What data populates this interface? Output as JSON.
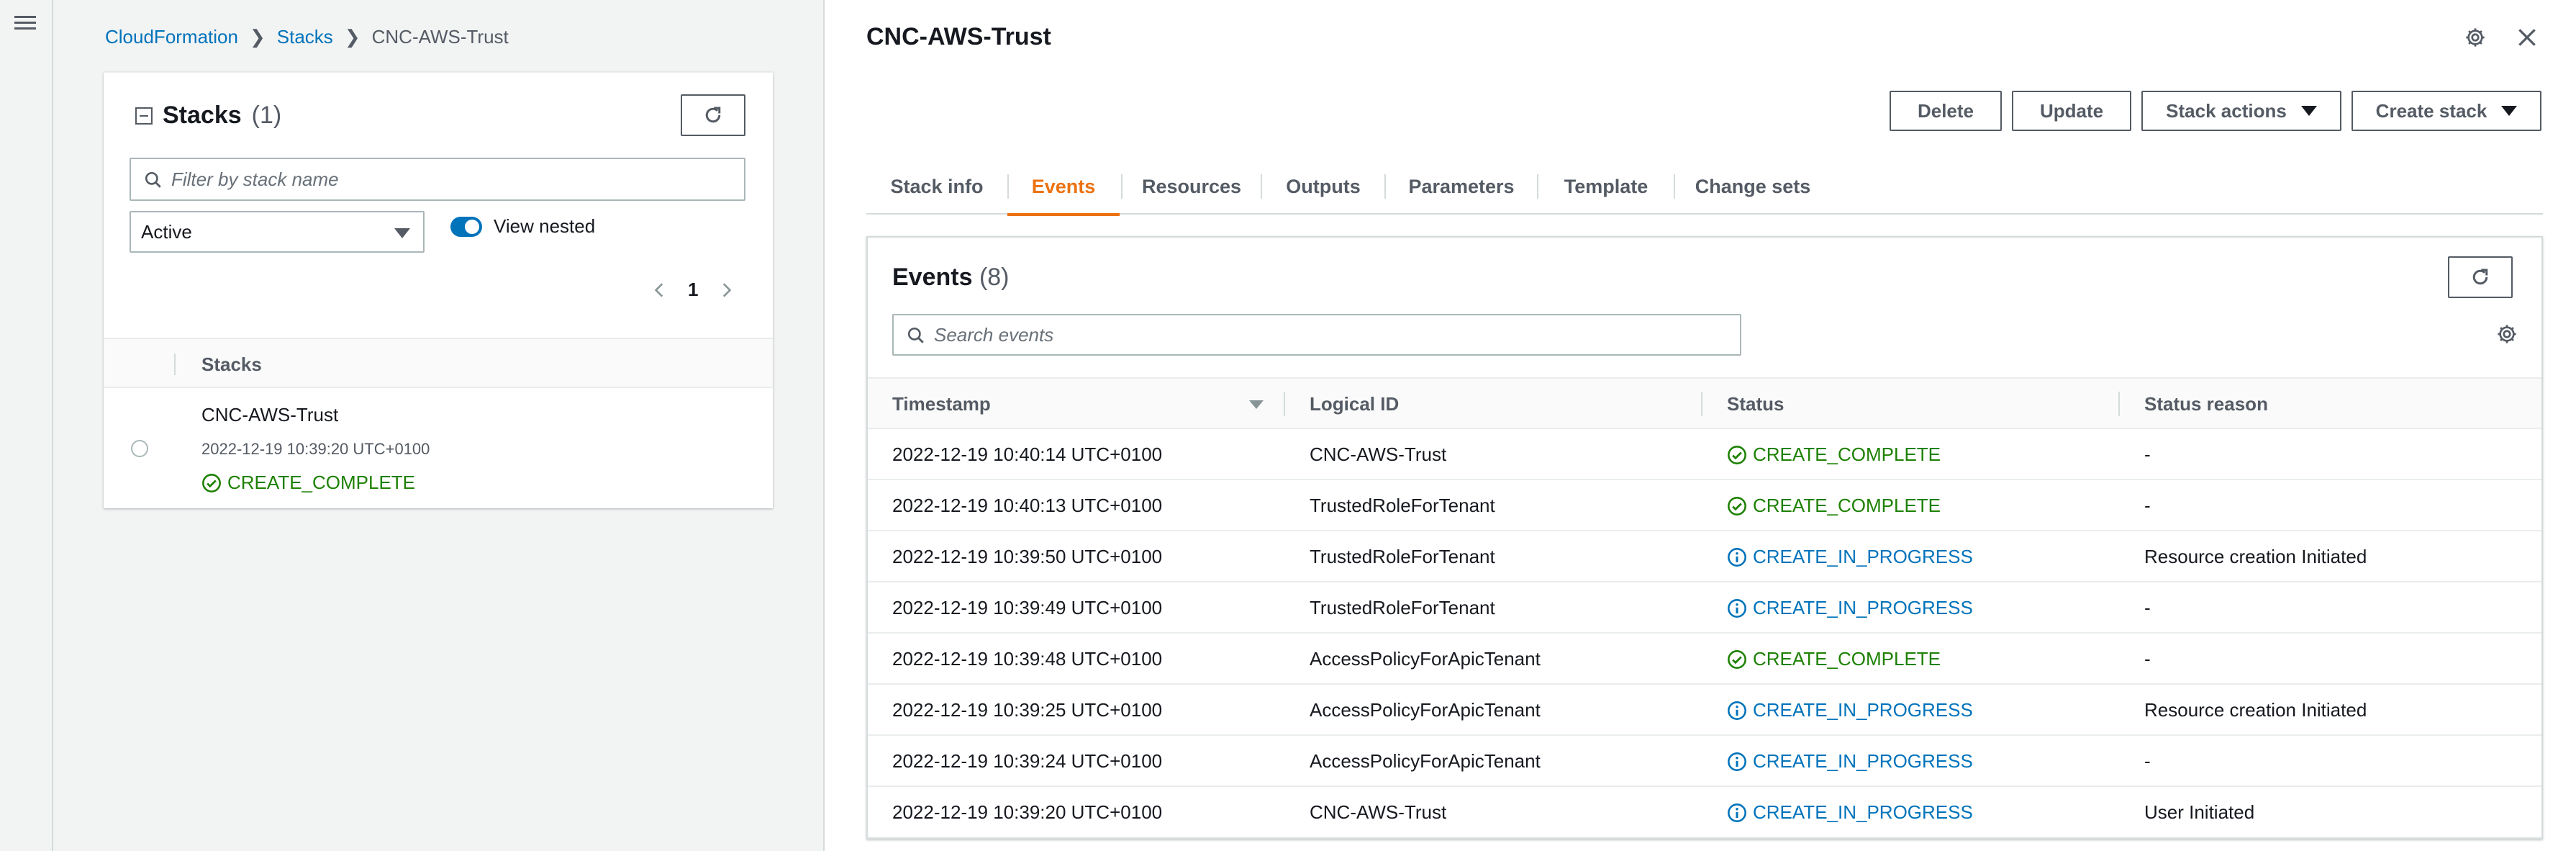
{
  "breadcrumb": {
    "items": [
      "CloudFormation",
      "Stacks",
      "CNC-AWS-Trust"
    ]
  },
  "stacks_panel": {
    "title": "Stacks",
    "count": "(1)",
    "filter_placeholder": "Filter by stack name",
    "status_filter": "Active",
    "view_nested_label": "View nested",
    "page": "1",
    "column_header": "Stacks",
    "rows": [
      {
        "name": "CNC-AWS-Trust",
        "time": "2022-12-19 10:39:20 UTC+0100",
        "status": "CREATE_COMPLETE"
      }
    ]
  },
  "detail": {
    "title": "CNC-AWS-Trust",
    "buttons": {
      "delete": "Delete",
      "update": "Update",
      "stack_actions": "Stack actions",
      "create_stack": "Create stack"
    },
    "tabs": [
      "Stack info",
      "Events",
      "Resources",
      "Outputs",
      "Parameters",
      "Template",
      "Change sets"
    ],
    "active_tab": "Events",
    "events": {
      "title": "Events",
      "count": "(8)",
      "search_placeholder": "Search events",
      "columns": [
        "Timestamp",
        "Logical ID",
        "Status",
        "Status reason"
      ],
      "rows": [
        {
          "timestamp": "2022-12-19 10:40:14 UTC+0100",
          "logical_id": "CNC-AWS-Trust",
          "status": "CREATE_COMPLETE",
          "kind": "complete",
          "reason": "-"
        },
        {
          "timestamp": "2022-12-19 10:40:13 UTC+0100",
          "logical_id": "TrustedRoleForTenant",
          "status": "CREATE_COMPLETE",
          "kind": "complete",
          "reason": "-"
        },
        {
          "timestamp": "2022-12-19 10:39:50 UTC+0100",
          "logical_id": "TrustedRoleForTenant",
          "status": "CREATE_IN_PROGRESS",
          "kind": "progress",
          "reason": "Resource creation Initiated"
        },
        {
          "timestamp": "2022-12-19 10:39:49 UTC+0100",
          "logical_id": "TrustedRoleForTenant",
          "status": "CREATE_IN_PROGRESS",
          "kind": "progress",
          "reason": "-"
        },
        {
          "timestamp": "2022-12-19 10:39:48 UTC+0100",
          "logical_id": "AccessPolicyForApicTenant",
          "status": "CREATE_COMPLETE",
          "kind": "complete",
          "reason": "-"
        },
        {
          "timestamp": "2022-12-19 10:39:25 UTC+0100",
          "logical_id": "AccessPolicyForApicTenant",
          "status": "CREATE_IN_PROGRESS",
          "kind": "progress",
          "reason": "Resource creation Initiated"
        },
        {
          "timestamp": "2022-12-19 10:39:24 UTC+0100",
          "logical_id": "AccessPolicyForApicTenant",
          "status": "CREATE_IN_PROGRESS",
          "kind": "progress",
          "reason": "-"
        },
        {
          "timestamp": "2022-12-19 10:39:20 UTC+0100",
          "logical_id": "CNC-AWS-Trust",
          "status": "CREATE_IN_PROGRESS",
          "kind": "progress",
          "reason": "User Initiated"
        }
      ]
    }
  },
  "colors": {
    "link": "#0073bb",
    "accent": "#ec7211",
    "success": "#1d8102",
    "info": "#0073bb"
  },
  "icons": [
    "menu-icon",
    "chevron-right-icon",
    "refresh-icon",
    "search-icon",
    "caret-down-icon",
    "chevron-left-icon",
    "success-icon",
    "info-icon",
    "gear-icon",
    "close-icon",
    "sort-icon",
    "resize-handle-icon"
  ]
}
